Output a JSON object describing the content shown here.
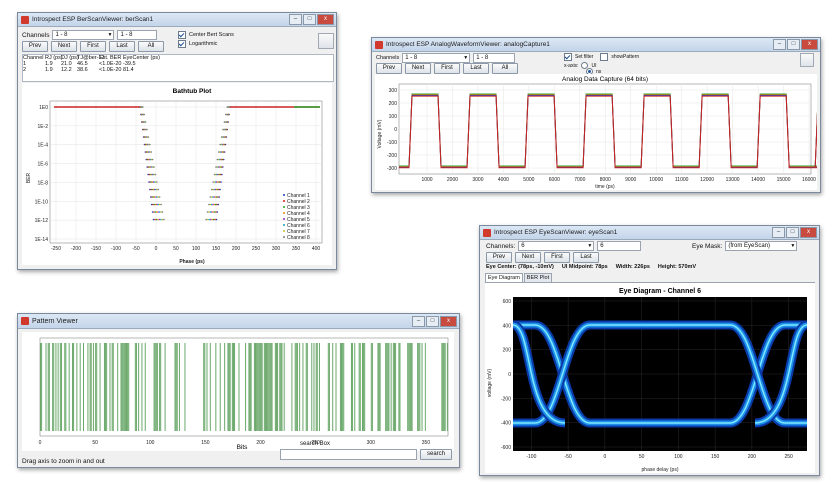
{
  "ber_window": {
    "title": "Introspect ESP BerScanViewer: berScan1",
    "channels_label": "Channels",
    "channel_from": "1 - 8",
    "channel_to": "1 - 8",
    "buttons": [
      "Prev",
      "Next",
      "First",
      "Last",
      "All"
    ],
    "center_label": "Center Bert Scans",
    "log_label": "Logarithmic",
    "table_headers": [
      "Channel",
      "RJ (ps)",
      "DJ (ps)",
      "TJ@ber-12",
      "Est. BER",
      "EyeCenter (ps)"
    ],
    "table_rows": [
      [
        "1",
        "1.9",
        "21.0",
        "46.5",
        "<1.0E-20",
        "-39.5"
      ],
      [
        "2",
        "1.9",
        "12.2",
        "38.6",
        "<1.0E-20",
        "81.4"
      ]
    ],
    "plot_title": "Bathtub Plot",
    "ylabel": "BER",
    "xlabel": "Phase (ps)",
    "y_ticks": [
      "1E0",
      "1E-2",
      "1E-4",
      "1E-6",
      "1E-8",
      "1E-10",
      "1E-12",
      "1E-14"
    ],
    "x_ticks": [
      "-250",
      "-200",
      "-150",
      "-100",
      "-50",
      "0",
      "50",
      "100",
      "150",
      "200",
      "250",
      "300",
      "350",
      "400"
    ],
    "legend": [
      "Channel 1",
      "Channel 2",
      "Channel 3",
      "Channel 4",
      "Channel 5",
      "Channel 6",
      "Channel 7",
      "Channel 8"
    ],
    "channel_colors": [
      "#1f3fbf",
      "#d92020",
      "#2aa02a",
      "#e08a00",
      "#9b30c0",
      "#1aa0b8",
      "#c0c020",
      "#7a7a7a"
    ]
  },
  "analog_window": {
    "title": "Introspect ESP AnalogWaveformViewer: analogCapture1",
    "channels_label": "Channels",
    "channel_from": "1 - 8",
    "channel_to": "1 - 8",
    "buttons": [
      "Prev",
      "Next",
      "First",
      "Last",
      "All"
    ],
    "filter_label": "Set filter",
    "pattern_label": "showPattern",
    "xaxis_label": "x-axis:",
    "radio_ui": "UI",
    "radio_ns": "ns",
    "plot_title": "Analog Data Capture (64 bits)",
    "ylabel": "Voltage (mV)",
    "xlabel": "time (ps)",
    "y_ticks": [
      "300",
      "200",
      "100",
      "0",
      "-100",
      "-200",
      "-300"
    ],
    "x_ticks": [
      "1000",
      "2000",
      "3000",
      "4000",
      "5000",
      "6000",
      "7000",
      "8000",
      "9000",
      "10000",
      "11000",
      "12000",
      "13000",
      "14000",
      "15000",
      "16000"
    ]
  },
  "pattern_window": {
    "title": "Pattern Viewer",
    "xlabel": "Bits",
    "x_ticks": [
      "0",
      "50",
      "100",
      "150",
      "200",
      "250",
      "300",
      "350"
    ],
    "search_label": "search Box",
    "search_button": "search",
    "status": "Drag axis to zoom in and out",
    "bar_color": "#6aa86a"
  },
  "eye_window": {
    "title": "Introspect ESP EyeScanViewer: eyeScan1",
    "channels_label": "Channels:",
    "channel_from": "6",
    "channel_to": "6",
    "eye_mask_label": "Eye Mask:",
    "eye_mask_value": "(from EyeScan)",
    "buttons": [
      "Prev",
      "Next",
      "First",
      "Last"
    ],
    "eye_center": "Eye Center: (78ps, -10mV)",
    "ui_midpoint": "UI Midpoint: 78ps",
    "width": "Width: 226ps",
    "height": "Height: 570mV",
    "tabs": [
      "Eye Diagram",
      "BER Plot"
    ],
    "plot_title": "Eye Diagram - Channel 6",
    "ylabel": "voltage (mV)",
    "xlabel": "phase delay (ps)",
    "y_ticks": [
      "600",
      "400",
      "200",
      "0",
      "-200",
      "-400",
      "-600"
    ],
    "x_ticks": [
      "-100",
      "-50",
      "0",
      "50",
      "100",
      "150",
      "200",
      "250"
    ]
  }
}
